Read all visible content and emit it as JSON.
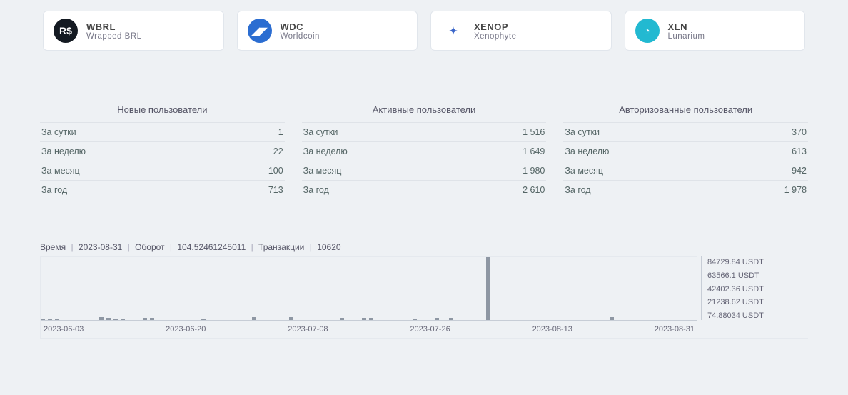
{
  "coins": [
    {
      "symbol": "WBRL",
      "name": "Wrapped BRL",
      "icon_bg": "#141a22",
      "icon_fg": "#fff",
      "icon_text": "R$"
    },
    {
      "symbol": "WDC",
      "name": "Worldcoin",
      "icon_bg": "#2b6dd1",
      "icon_fg": "#fff",
      "icon_text": "◢◤"
    },
    {
      "symbol": "XENOP",
      "name": "Xenophyte",
      "icon_bg": "#fff",
      "icon_fg": "#3b66c9",
      "icon_text": "✦"
    },
    {
      "symbol": "XLN",
      "name": "Lunarium",
      "icon_bg": "#22b9d1",
      "icon_fg": "#fff",
      "icon_text": "◔"
    }
  ],
  "stats": {
    "row_labels": [
      "За сутки",
      "За неделю",
      "За месяц",
      "За год"
    ],
    "blocks": [
      {
        "title": "Новые пользователи",
        "values": [
          "1",
          "22",
          "100",
          "713"
        ]
      },
      {
        "title": "Активные пользователи",
        "values": [
          "1 516",
          "1 649",
          "1 980",
          "2 610"
        ]
      },
      {
        "title": "Авторизованные пользователи",
        "values": [
          "370",
          "613",
          "942",
          "1 978"
        ]
      }
    ]
  },
  "chart_info": {
    "time_label": "Время",
    "time_value": "2023-08-31",
    "turnover_label": "Оборот",
    "turnover_value": "104.52461245011",
    "tx_label": "Транзакции",
    "tx_value": "10620"
  },
  "chart_data": {
    "type": "bar",
    "title": "",
    "xlabel": "",
    "ylabel": "USDT",
    "ylim": [
      0,
      85000
    ],
    "x_ticks": [
      "2023-06-03",
      "2023-06-20",
      "2023-07-08",
      "2023-07-26",
      "2023-08-13",
      "2023-08-31"
    ],
    "y_ticks": [
      "84729.84 USDT",
      "63566.1 USDT",
      "42402.36 USDT",
      "21238.62 USDT",
      "74.88034 USDT"
    ],
    "categories_note": "Days 2023-06-03 .. 2023-08-31 (90 days). Values below ≈ USDT turnover per day, estimated from axis.",
    "values": [
      1800,
      600,
      500,
      400,
      300,
      300,
      300,
      300,
      4200,
      3100,
      700,
      500,
      300,
      300,
      3000,
      2800,
      400,
      300,
      300,
      300,
      300,
      300,
      700,
      300,
      300,
      300,
      300,
      300,
      300,
      3400,
      300,
      300,
      300,
      300,
      3400,
      300,
      300,
      300,
      300,
      300,
      300,
      2600,
      300,
      300,
      3000,
      2500,
      300,
      300,
      300,
      300,
      300,
      2400,
      300,
      300,
      3200,
      300,
      2800,
      300,
      300,
      300,
      300,
      84730,
      300,
      300,
      300,
      300,
      300,
      300,
      300,
      300,
      300,
      300,
      300,
      300,
      300,
      300,
      300,
      300,
      3700,
      300,
      300,
      300,
      300,
      300,
      300,
      300,
      300,
      300,
      300,
      105
    ]
  }
}
